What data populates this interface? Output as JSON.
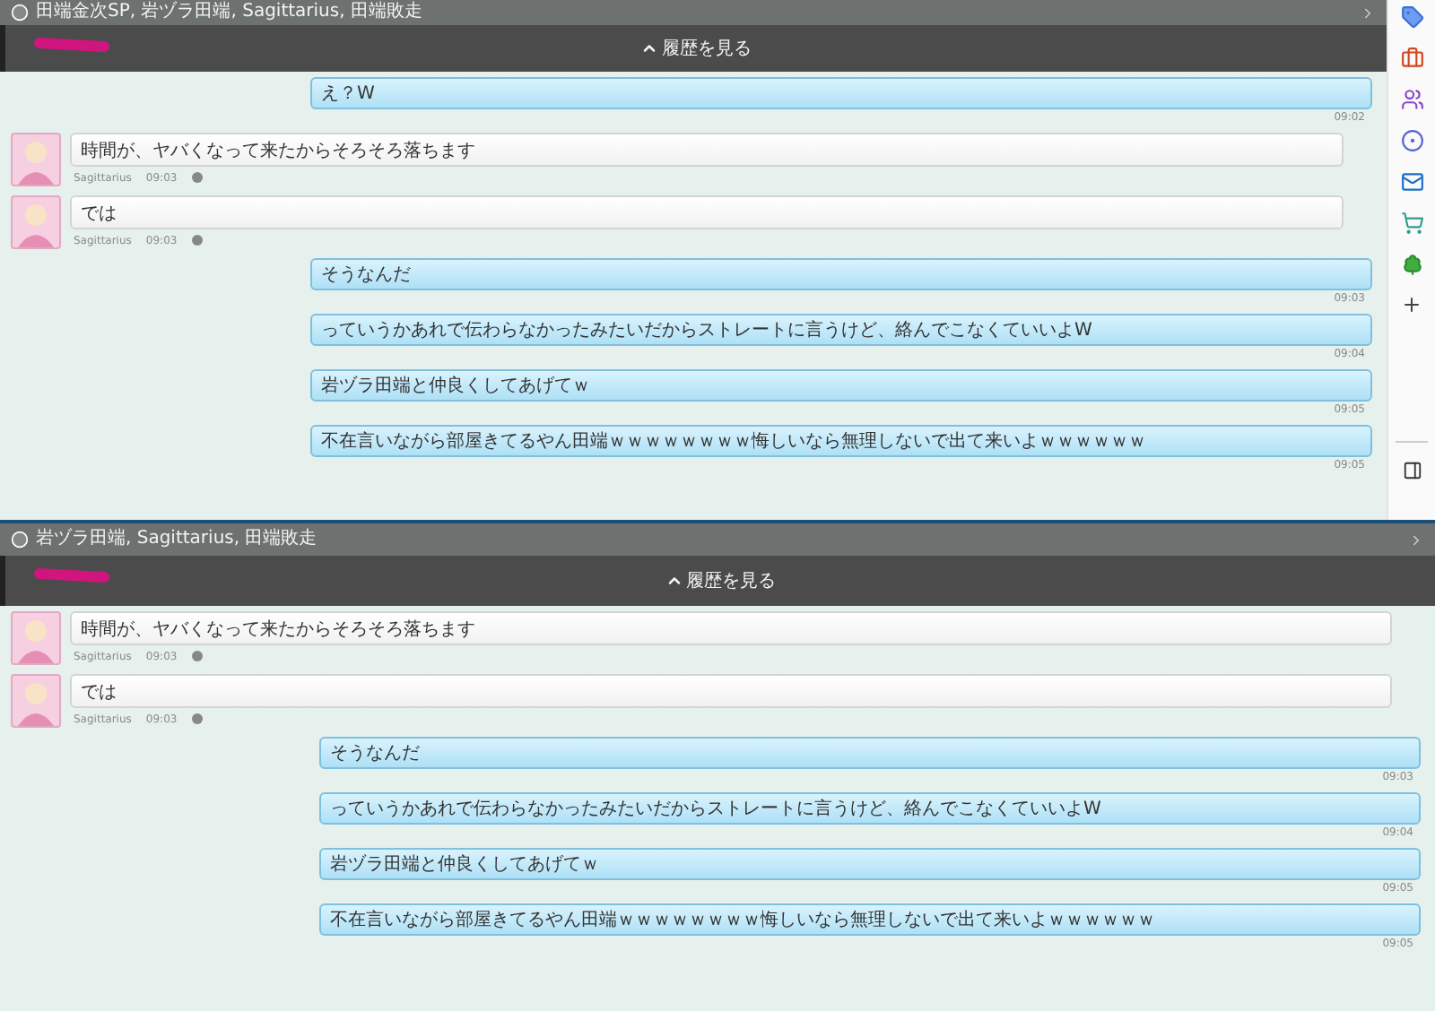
{
  "panels": [
    {
      "header": {
        "participants": "田端金次SP, 岩ヅラ田端, Sagittarius, 田端敗走"
      },
      "history_button": "履歴を見る",
      "messages": [
        {
          "kind": "sent",
          "text": "え？W",
          "time": "09:02"
        },
        {
          "kind": "received",
          "text": "時間が、ヤバくなって来たからそろそろ落ちます",
          "sender": "Sagittarius",
          "time": "09:03"
        },
        {
          "kind": "received",
          "text": "では",
          "sender": "Sagittarius",
          "time": "09:03"
        },
        {
          "kind": "sent",
          "text": "そうなんだ",
          "time": "09:03"
        },
        {
          "kind": "sent",
          "text": "っていうかあれで伝わらなかったみたいだからストレートに言うけど、絡んでこなくていいよW",
          "time": "09:04"
        },
        {
          "kind": "sent",
          "text": "岩ヅラ田端と仲良くしてあげてｗ",
          "time": "09:05"
        },
        {
          "kind": "sent",
          "text": "不在言いながら部屋きてるやん田端ｗｗｗｗｗｗｗｗ悔しいなら無理しないで出て来いよｗｗｗｗｗｗ",
          "time": "09:05"
        }
      ]
    },
    {
      "header": {
        "participants": "岩ヅラ田端, Sagittarius, 田端敗走"
      },
      "history_button": "履歴を見る",
      "messages": [
        {
          "kind": "received",
          "text": "時間が、ヤバくなって来たからそろそろ落ちます",
          "sender": "Sagittarius",
          "time": "09:03"
        },
        {
          "kind": "received",
          "text": "では",
          "sender": "Sagittarius",
          "time": "09:03"
        },
        {
          "kind": "sent",
          "text": "そうなんだ",
          "time": "09:03"
        },
        {
          "kind": "sent",
          "text": "っていうかあれで伝わらなかったみたいだからストレートに言うけど、絡んでこなくていいよW",
          "time": "09:04"
        },
        {
          "kind": "sent",
          "text": "岩ヅラ田端と仲良くしてあげてｗ",
          "time": "09:05"
        },
        {
          "kind": "sent",
          "text": "不在言いながら部屋きてるやん田端ｗｗｗｗｗｗｗｗ悔しいなら無理しないで出て来いよｗｗｗｗｗｗ",
          "time": "09:05"
        }
      ]
    }
  ]
}
